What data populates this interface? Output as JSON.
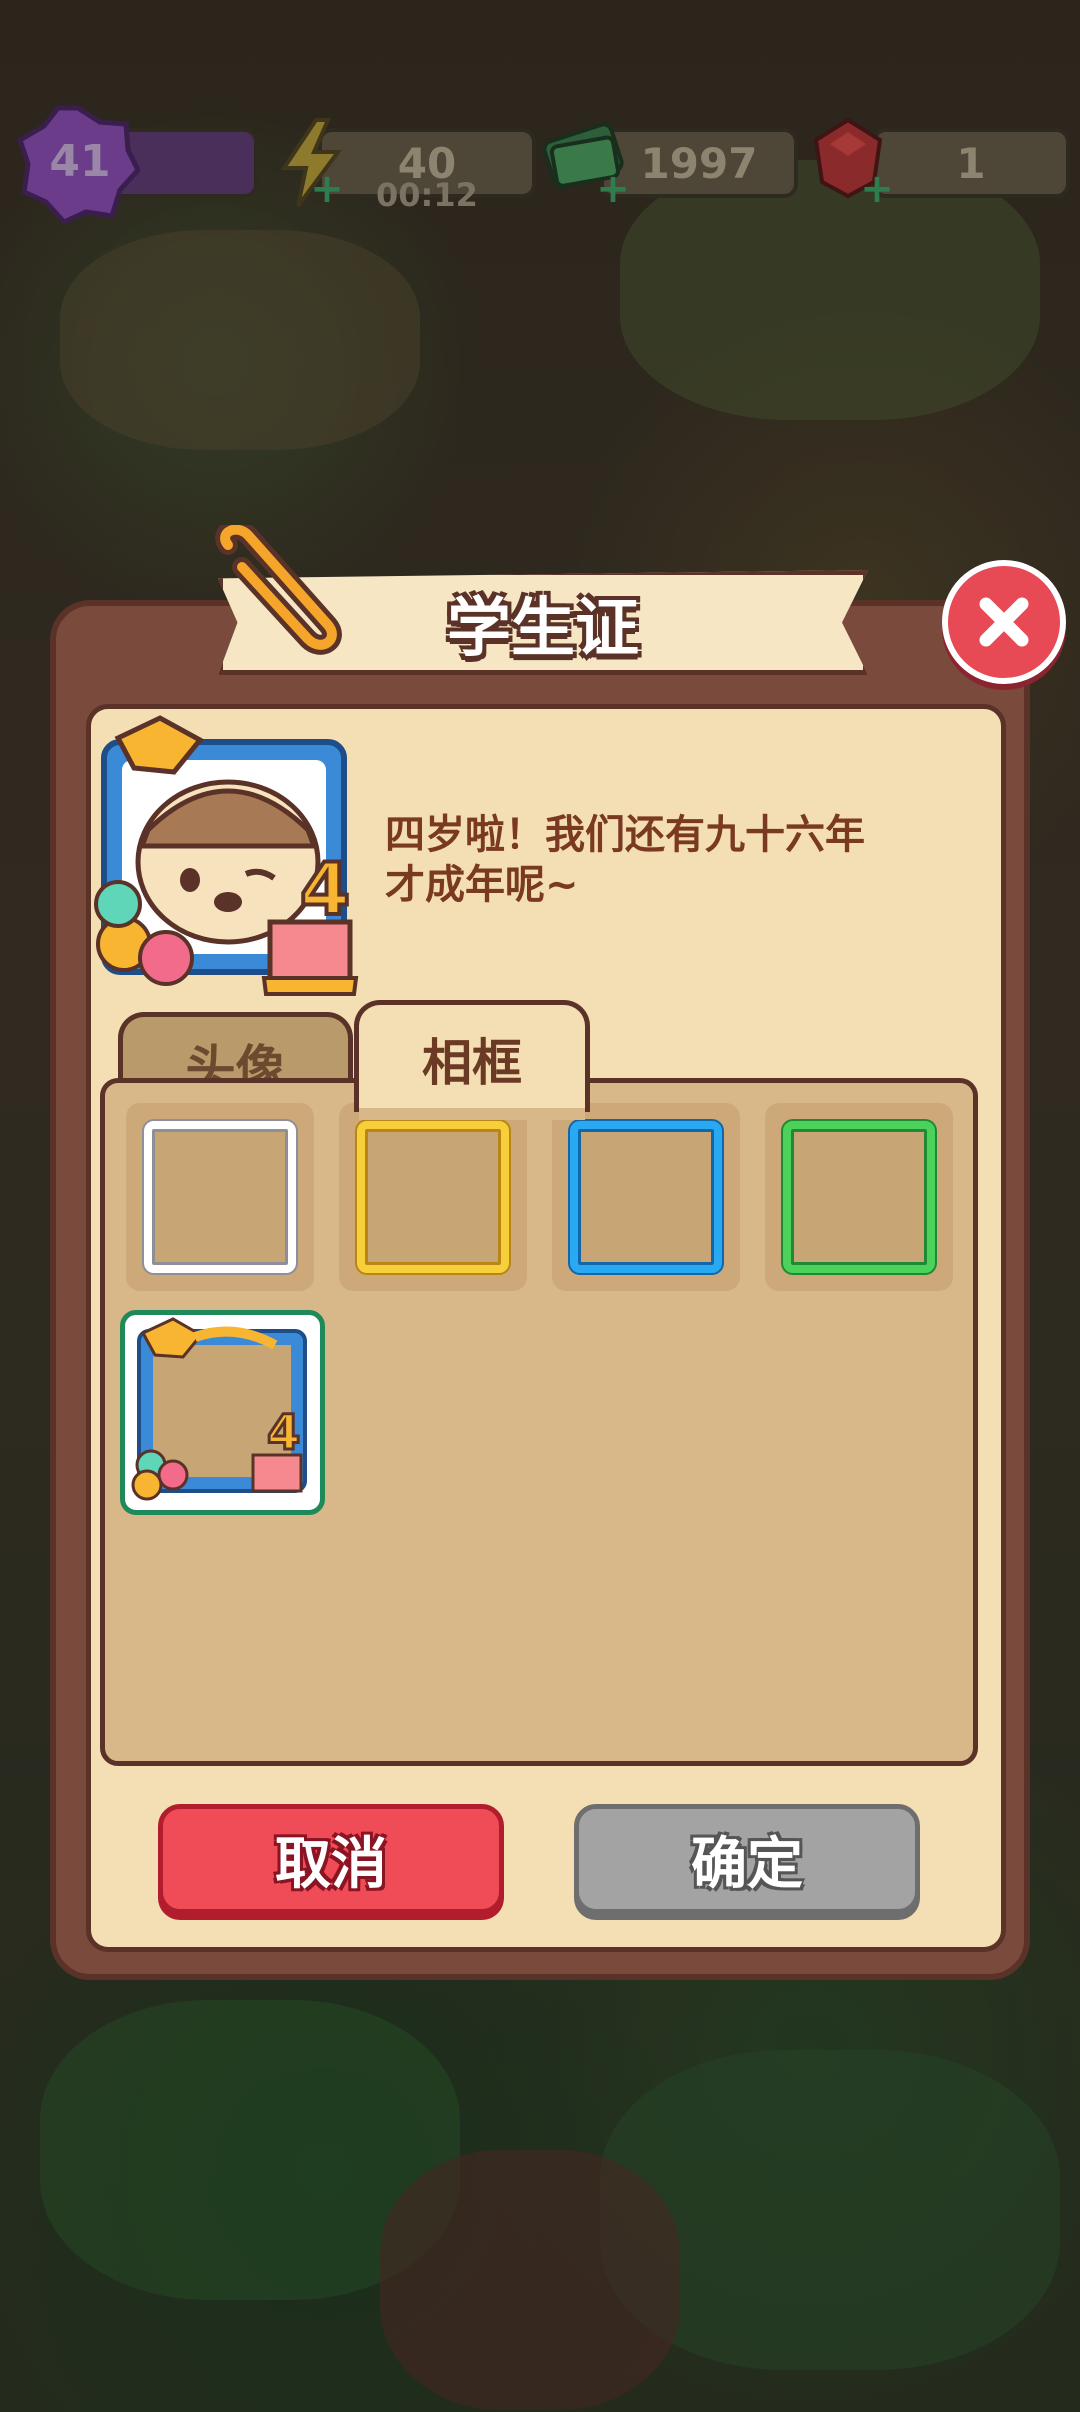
{
  "hud": {
    "level": "41",
    "energy": "40",
    "energy_timer": "00:12",
    "cash": "1997",
    "gems": "1"
  },
  "dialog": {
    "title": "学生证",
    "description_line1": "四岁啦！我们还有九十六年",
    "description_line2": "才成年呢~",
    "tabs": [
      {
        "label": "头像",
        "active": false
      },
      {
        "label": "相框",
        "active": true
      }
    ],
    "frames": [
      {
        "style": "white"
      },
      {
        "style": "gold"
      },
      {
        "style": "blue"
      },
      {
        "style": "green"
      },
      {
        "style": "birthday-4",
        "selected": true
      }
    ],
    "cancel_label": "取消",
    "confirm_label": "确定"
  },
  "colors": {
    "cancel": "#f04c58",
    "confirm": "#a3a3a3",
    "panel": "#7a4a3c",
    "card": "#f4dfb5"
  }
}
